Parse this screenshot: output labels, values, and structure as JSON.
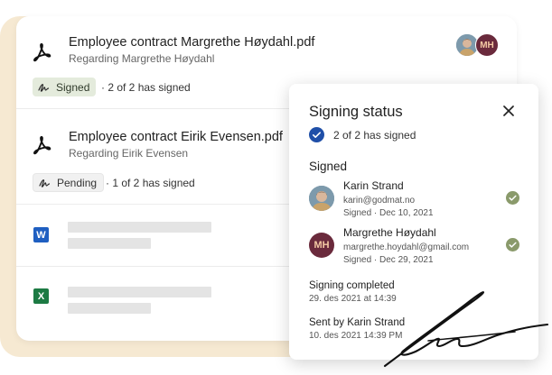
{
  "documents": [
    {
      "title": "Employee contract Margrethe Høydahl.pdf",
      "subtitle": "Regarding Margrethe Høydahl",
      "status": "Signed",
      "progress": "· 2 of 2 has signed",
      "avatar_initials": "MH"
    },
    {
      "title": "Employee contract Eirik Evensen.pdf",
      "subtitle": "Regarding Eirik Evensen",
      "status": "Pending",
      "progress": "· 1 of 2 has signed"
    }
  ],
  "file_icons": {
    "word": "W",
    "excel": "X"
  },
  "signing_panel": {
    "title": "Signing status",
    "count": "2 of 2 has signed",
    "signed_heading": "Signed",
    "signers": [
      {
        "name": "Karin Strand",
        "email": "karin@godmat.no",
        "date": "Signed · Dec 10, 2021"
      },
      {
        "name": "Margrethe Høydahl",
        "initials": "MH",
        "email": "margrethe.hoydahl@gmail.com",
        "date": "Signed · Dec 29, 2021"
      }
    ],
    "completed_label": "Signing completed",
    "completed_date": "29. des 2021 at 14:39",
    "sent_by_label": "Sent by Karin Strand",
    "sent_by_date": "10. des 2021 14:39 PM"
  },
  "colors": {
    "backdrop": "#f6e9d2",
    "signed_badge": "#e4ebdc",
    "check_blue": "#1f4fa8",
    "check_green": "#8a9a6b",
    "word_blue": "#1f5fc1",
    "excel_green": "#1c7a43",
    "avatar_mh": "#6a2a3c"
  },
  "icons": [
    "pdf-icon",
    "signature-pen-icon",
    "word-icon",
    "excel-icon",
    "close-icon",
    "check-circle-icon"
  ]
}
